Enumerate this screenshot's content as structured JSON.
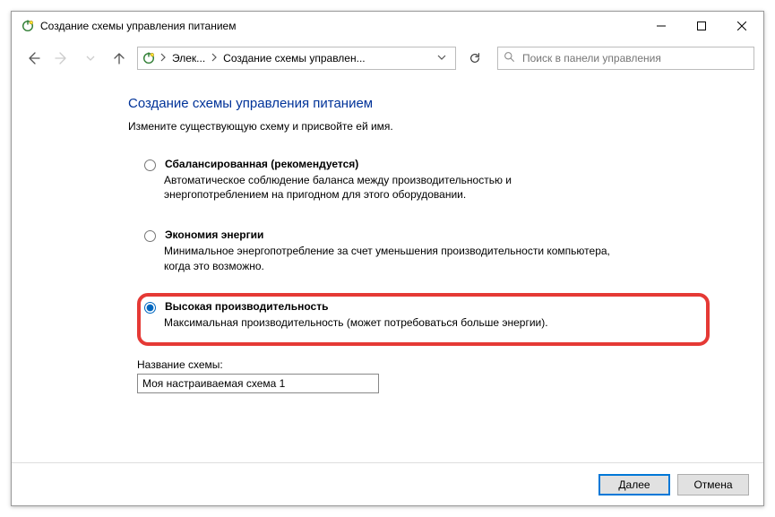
{
  "titlebar": {
    "title": "Создание схемы управления питанием"
  },
  "breadcrumb": {
    "seg1": "Элек...",
    "seg2": "Создание схемы управлен..."
  },
  "search": {
    "placeholder": "Поиск в панели управления"
  },
  "page": {
    "heading": "Создание схемы управления питанием",
    "subtext": "Измените существующую схему и присвойте ей имя."
  },
  "plans": {
    "balanced": {
      "title": "Сбалансированная (рекомендуется)",
      "desc": "Автоматическое соблюдение баланса между производительностью и энергопотреблением на пригодном для этого оборудовании."
    },
    "saver": {
      "title": "Экономия энергии",
      "desc": "Минимальное энергопотребление за счет уменьшения производительности компьютера, когда это возможно."
    },
    "high": {
      "title": "Высокая производительность",
      "desc": "Максимальная производительность (может потребоваться больше энергии)."
    }
  },
  "nameField": {
    "label": "Название схемы:",
    "value": "Моя настраиваемая схема 1"
  },
  "buttons": {
    "next": "Далее",
    "cancel": "Отмена"
  }
}
